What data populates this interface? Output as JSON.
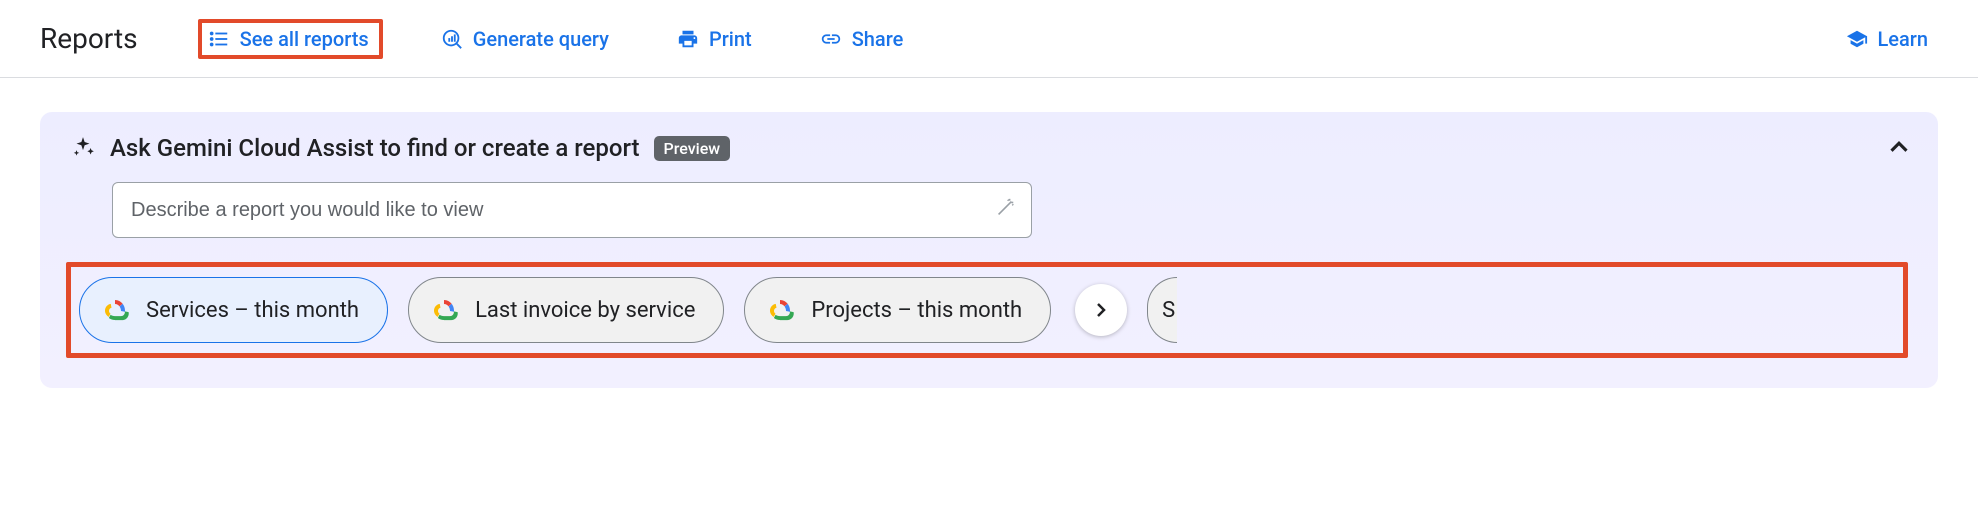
{
  "header": {
    "title": "Reports",
    "actions": {
      "see_all": "See all reports",
      "generate_query": "Generate query",
      "print": "Print",
      "share": "Share",
      "learn": "Learn"
    }
  },
  "panel": {
    "title": "Ask Gemini Cloud Assist to find or create a report",
    "badge": "Preview",
    "input_placeholder": "Describe a report you would like to view",
    "chips": [
      {
        "label": "Services – this month",
        "selected": true
      },
      {
        "label": "Last invoice by service",
        "selected": false
      },
      {
        "label": "Projects – this month",
        "selected": false
      }
    ],
    "overflow_hint": "S"
  },
  "icons": {
    "sparkle": "sparkle-icon",
    "list": "list-icon",
    "query": "query-icon",
    "print": "print-icon",
    "share": "link-icon",
    "learn": "graduation-cap-icon",
    "wand": "wand-icon",
    "chevron_up": "chevron-up-icon",
    "chevron_right": "chevron-right-icon",
    "gcloud": "google-cloud-icon"
  },
  "colors": {
    "accent": "#1a73e8",
    "highlight": "#e24a2a"
  }
}
